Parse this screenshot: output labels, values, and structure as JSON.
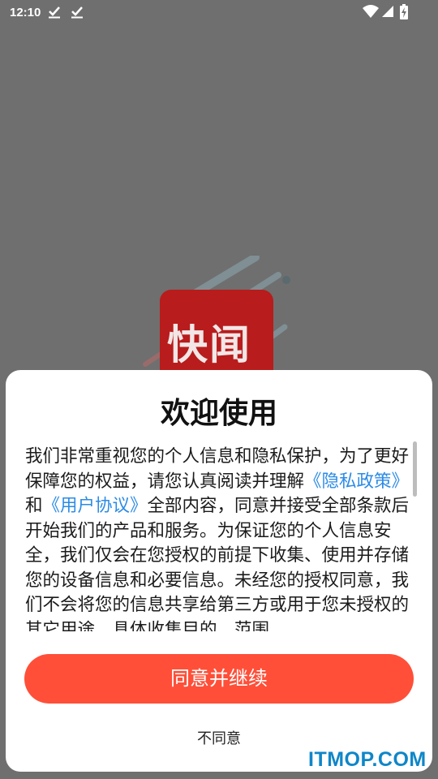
{
  "status_bar": {
    "time": "12:10",
    "icons": [
      "check-icon",
      "check-icon",
      "wifi-icon",
      "signal-icon",
      "battery-icon"
    ]
  },
  "app": {
    "logo_text": "快闻",
    "logo_color": "#b81c1c"
  },
  "dialog": {
    "title": "欢迎使用",
    "body_part1": "我们非常重视您的个人信息和隐私保护，为了更好保障您的权益，请您认真阅读并理解",
    "privacy_link": "《隐私政策》",
    "conjunction": "和",
    "terms_link": "《用户协议》",
    "body_part2": "全部内容，同意并接受全部条款后开始我们的产品和服务。为保证您的个人信息安全，我们仅会在您授权的前提下收集、使用并存储您的设备信息和必要信息。未经您的授权同意，我们不会将您的信息共享给第三方或用于您未授权的其它用途，具体收集目的、范围",
    "agree_button": "同意并继续",
    "disagree_button": "不同意",
    "accent_color": "#ff4f38",
    "link_color": "#2b8be6"
  },
  "watermark": "ITMOP.COM"
}
